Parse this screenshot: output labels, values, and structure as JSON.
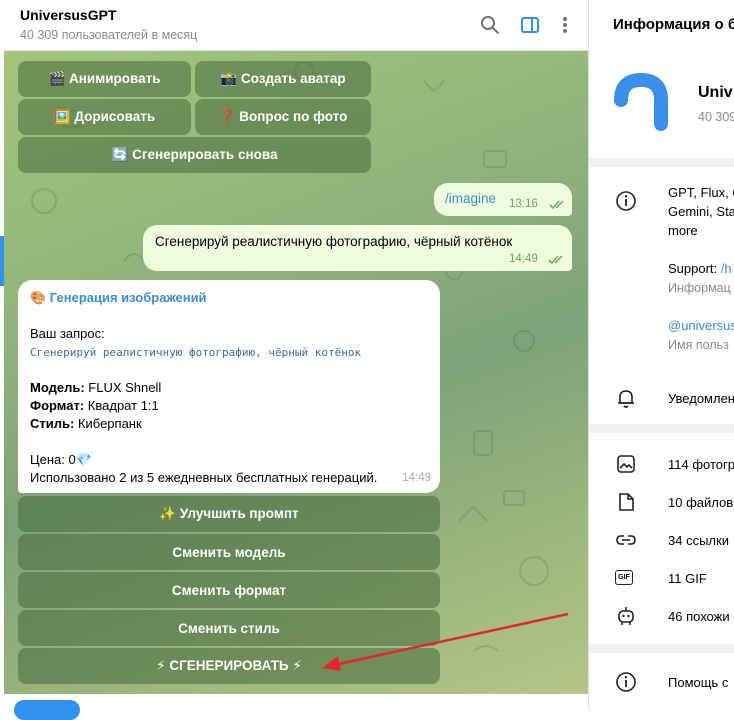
{
  "chat": {
    "title": "UniversusGPT",
    "subtitle": "40 309 пользователей в месяц"
  },
  "top_keyboard": {
    "row1": [
      "🎬 Анимировать",
      "📸 Создать аватар"
    ],
    "row2": [
      "🖼️ Дорисовать",
      "❓ Вопрос по фото"
    ],
    "row3": "🔄 Сгенерировать снова"
  },
  "messages": {
    "out1": {
      "text": "/imagine",
      "time": "13:16"
    },
    "out2": {
      "text": "Сгенерируй реалистичную фотографию, чёрный котёнок",
      "time": "14:49"
    },
    "bot": {
      "header": "🎨 Генерация изображений",
      "request_label": "Ваш запрос:",
      "request_text": "Сгенерируй реалистичную фотографию, чёрный котёнок",
      "model_label": "Модель:",
      "model_value": " FLUX Shnell",
      "format_label": "Формат:",
      "format_value": " Квадрат 1:1",
      "style_label": "Стиль:",
      "style_value": " Киберпанк",
      "price": "Цена: 0💎",
      "usage": "Использовано 2 из 5 ежедневных бесплатных генераций.",
      "time": "14:49"
    }
  },
  "bot_keyboard": [
    "✨ Улучшить промпт",
    "Сменить модель",
    "Сменить формат",
    "Сменить стиль",
    "⚡ СГЕНЕРИРОВАТЬ ⚡"
  ],
  "info_panel": {
    "title": "Информация о б",
    "name": "Univ",
    "count": "40 309",
    "desc_lines": [
      "GPT, Flux, C",
      "Gemini, Sta",
      "more"
    ],
    "support": "Support: ",
    "support_link": "/h",
    "support_sub": "Информац",
    "username": "@universus",
    "username_sub": "Имя польз",
    "notifications": "Уведомлен",
    "media": {
      "photos": "114 фотогр",
      "files": "10 файлов",
      "links": "34 ссылки",
      "gif": "11 GIF",
      "similar": "46 похожи"
    },
    "help": "Помощь с",
    "gif_badge": "GIF"
  },
  "colors": {
    "accent": "#3390ec",
    "outgoing_bubble": "#effdde",
    "check_green": "#62ac55",
    "arrow_red": "#e4262a"
  }
}
